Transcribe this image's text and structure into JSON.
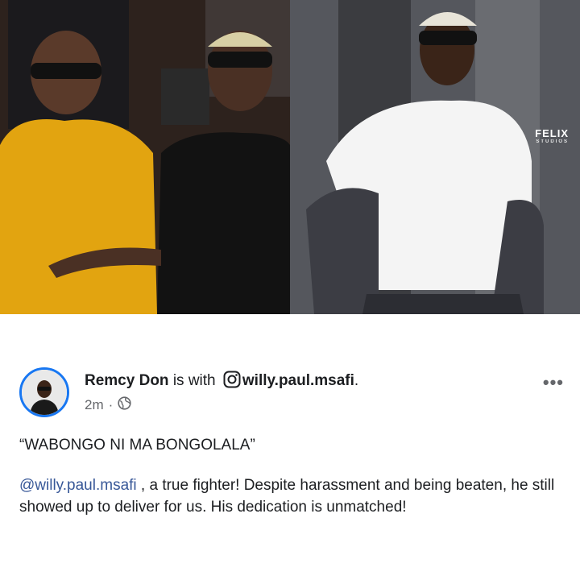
{
  "photos": {
    "left": {
      "description_icon": "photo-icon"
    },
    "right": {
      "watermark": "FELIX",
      "watermark_sub": "STUDIOS"
    }
  },
  "post": {
    "author": "Remcy Don",
    "with_text": "is with",
    "tagged_user": "willy.paul.msafi",
    "tagged_suffix": ".",
    "time": "2m",
    "separator": "·",
    "privacy_icon": "globe-icon",
    "more_label": "•••",
    "quote": "“WABONGO NI MA BONGOLALA”",
    "mention": "@willy.paul.msafi",
    "body_text": " , a true fighter! Despite harassment and being beaten, he still showed up to deliver for us. His dedication is unmatched!"
  },
  "colors": {
    "link": "#385898",
    "avatar_ring": "#1877f2",
    "meta": "#65676b"
  }
}
